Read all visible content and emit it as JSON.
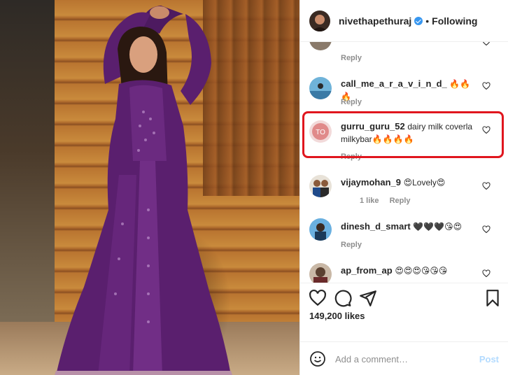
{
  "post_header": {
    "username": "nivethapethuraj",
    "separator": "•",
    "follow_status": "Following"
  },
  "comments": [
    {
      "reply_label": "Reply"
    },
    {
      "username": "call_me_a_r_a_v_i_n_d_",
      "text": "🔥🔥🔥",
      "reply_label": "Reply"
    },
    {
      "username": "gurru_guru_52",
      "text": "dairy milk coverla milkybar🔥🔥🔥🔥",
      "reply_label": "Reply",
      "avatar_text": "TO"
    },
    {
      "username": "vijaymohan_9",
      "text": "😍Lovely😍",
      "likes_label": "1 like",
      "reply_label": "Reply"
    },
    {
      "username": "dinesh_d_smart",
      "text": "🖤🖤🖤😘😍",
      "reply_label": "Reply"
    },
    {
      "username": "ap_from_ap",
      "text": "😍😍😍😘😘😘"
    }
  ],
  "likes_count": "149,200 likes",
  "comment_input": {
    "placeholder": "Add a comment…",
    "post_label": "Post"
  },
  "colors": {
    "highlight": "#e0161e",
    "verified": "#3897f0",
    "post_disabled": "#b3dbff",
    "dress": "#5a1f6e"
  },
  "icons": [
    "heart-icon",
    "comment-icon",
    "share-icon",
    "bookmark-icon",
    "emoji-icon",
    "verified-badge-icon"
  ]
}
